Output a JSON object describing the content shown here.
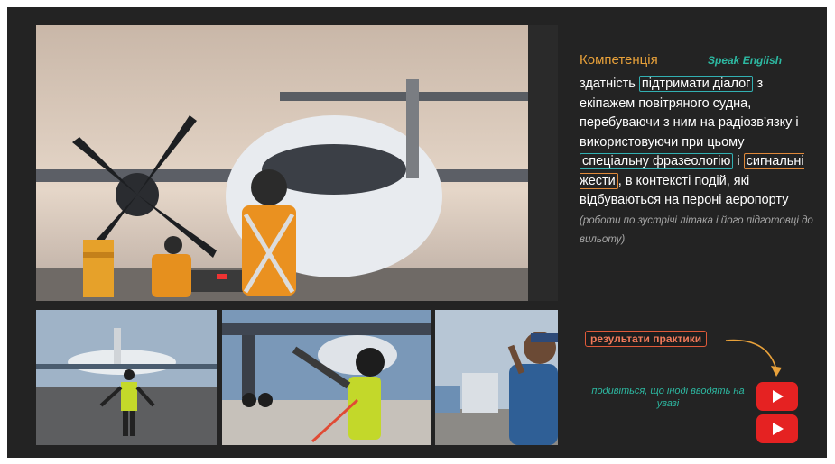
{
  "slide": {
    "heading": "Компетенція",
    "speak": "Speak English",
    "text": {
      "p1": "здатність ",
      "h1": "підтримати діалог",
      "p2": " з екіпажем повітряного судна, перебуваючи з ним на радіозв’язку і використовуючи при цьому ",
      "h2": "спеціальну фразеологію",
      "p3": " і ",
      "h3": "сигнальні жести",
      "p4": ", в контексті подій, які відбуваються на пероні аеропорту ",
      "note": "(роботи по зустрічі літака і його підготовці до вильоту)"
    },
    "results_label": "результати практики",
    "watch_text": "подивіться, що іноді вводять на увазі"
  },
  "photos": [
    "photo-main",
    "photo-bl",
    "photo-bm",
    "photo-br"
  ],
  "colors": {
    "background": "#232323",
    "heading": "#e8a13a",
    "accent_teal": "#2db9a2",
    "highlight_orange": "#e0893a",
    "results_red": "#e05a3a",
    "youtube_red": "#e52222"
  },
  "icons": [
    "youtube-play-icon",
    "youtube-play-icon"
  ]
}
